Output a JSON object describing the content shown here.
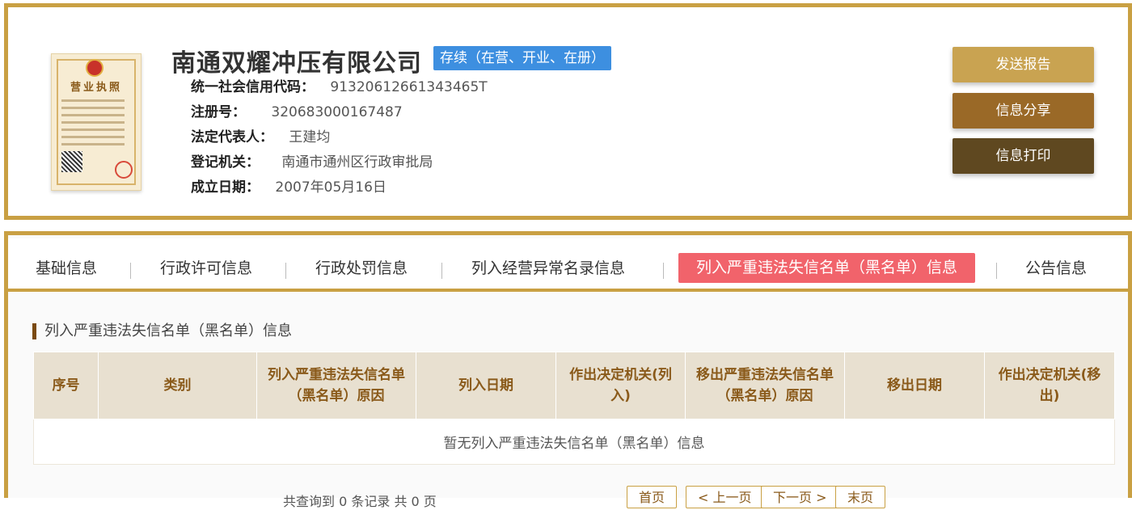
{
  "company": {
    "name": "南通双耀冲压有限公司",
    "status": "存续（在营、开业、在册）",
    "license_title": "营业执照",
    "fields": [
      {
        "label": "统一社会信用代码：",
        "value": "91320612661343465T"
      },
      {
        "label": "注册号：",
        "value": "320683000167487"
      },
      {
        "label": "法定代表人：",
        "value": "王建均"
      },
      {
        "label": "登记机关：",
        "value": "南通市通州区行政审批局"
      },
      {
        "label": "成立日期：",
        "value": "2007年05月16日"
      }
    ]
  },
  "actions": {
    "send_report": "发送报告",
    "share_info": "信息分享",
    "print_info": "信息打印"
  },
  "tabs": [
    {
      "label": "基础信息",
      "active": false
    },
    {
      "label": "行政许可信息",
      "active": false
    },
    {
      "label": "行政处罚信息",
      "active": false
    },
    {
      "label": "列入经营异常名录信息",
      "active": false
    },
    {
      "label": "列入严重违法失信名单（黑名单）信息",
      "active": true
    },
    {
      "label": "公告信息",
      "active": false
    }
  ],
  "section": {
    "title": "列入严重违法失信名单（黑名单）信息",
    "columns": [
      "序号",
      "类别",
      "列入严重违法失信名单（黑名单）原因",
      "列入日期",
      "作出决定机关(列入)",
      "移出严重违法失信名单（黑名单）原因",
      "移出日期",
      "作出决定机关(移出)"
    ],
    "empty_text": "暂无列入严重违法失信名单（黑名单）信息"
  },
  "pagination": {
    "summary": "共查询到 0 条记录 共 0 页",
    "first": "首页",
    "prev": "< 上一页",
    "next": "下一页 >",
    "last": "末页"
  },
  "colors": {
    "border_gold": "#c9a043",
    "status_blue": "#3d8fe0",
    "active_tab": "#f1636b"
  }
}
